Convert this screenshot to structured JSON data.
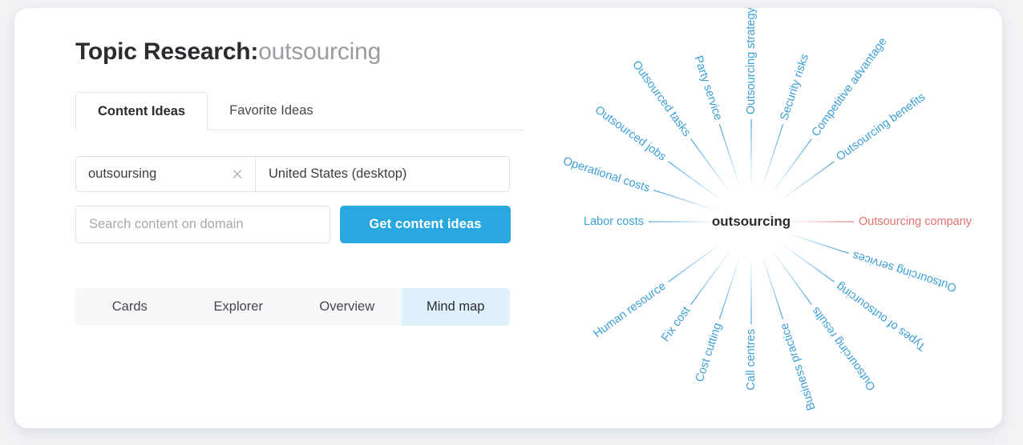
{
  "header": {
    "title_prefix": "Topic Research:",
    "title_keyword": "outsourcing"
  },
  "tabs": [
    {
      "label": "Content Ideas",
      "active": true
    },
    {
      "label": "Favorite Ideas",
      "active": false
    }
  ],
  "search": {
    "keyword_value": "outsoursing",
    "clear_icon": "close-icon",
    "locale_value": "United States (desktop)",
    "domain_placeholder": "Search content on domain",
    "domain_value": "",
    "submit_label": "Get content ideas"
  },
  "view_switch": [
    {
      "label": "Cards",
      "active": false
    },
    {
      "label": "Explorer",
      "active": false
    },
    {
      "label": "Overview",
      "active": false
    },
    {
      "label": "Mind map",
      "active": true
    }
  ],
  "colors": {
    "accent_blue": "#29a8e0",
    "node_blue": "#3d9fd8",
    "node_red": "#e0736e",
    "active_view_bg": "#dff1fb",
    "card_bg": "#ffffff",
    "page_bg": "#f2f3f5"
  },
  "chart_data": {
    "type": "mindmap",
    "title": "outsourcing",
    "center": "outsourcing",
    "radius": 225,
    "node_count": 20,
    "nodes": [
      {
        "label": "Outsourcing company",
        "angle": 0,
        "color": "#e0736e"
      },
      {
        "label": "Outsourcing services",
        "angle": 342,
        "color": "#3d9fd8"
      },
      {
        "label": "Types of outsourcing",
        "angle": 324,
        "color": "#3d9fd8"
      },
      {
        "label": "Outsourcing results",
        "angle": 306,
        "color": "#3d9fd8"
      },
      {
        "label": "Business practice",
        "angle": 288,
        "color": "#3d9fd8"
      },
      {
        "label": "Call centres",
        "angle": 270,
        "color": "#3d9fd8"
      },
      {
        "label": "Cost cutting",
        "angle": 252,
        "color": "#3d9fd8"
      },
      {
        "label": "Fix cost",
        "angle": 234,
        "color": "#3d9fd8"
      },
      {
        "label": "Human resource",
        "angle": 216,
        "color": "#3d9fd8"
      },
      {
        "label": "Labor costs",
        "angle": 180,
        "color": "#3d9fd8"
      },
      {
        "label": "Operational costs",
        "angle": 162,
        "color": "#3d9fd8"
      },
      {
        "label": "Outsourced jobs",
        "angle": 144,
        "color": "#3d9fd8"
      },
      {
        "label": "Outsourced tasks",
        "angle": 126,
        "color": "#3d9fd8"
      },
      {
        "label": "Party service",
        "angle": 108,
        "color": "#3d9fd8"
      },
      {
        "label": "Outsourcing strategy",
        "angle": 90,
        "color": "#3d9fd8"
      },
      {
        "label": "Security risks",
        "angle": 72,
        "color": "#3d9fd8"
      },
      {
        "label": "Competitive advantage",
        "angle": 54,
        "color": "#3d9fd8"
      },
      {
        "label": "Outsourcing benefits",
        "angle": 36,
        "color": "#3d9fd8"
      }
    ]
  }
}
